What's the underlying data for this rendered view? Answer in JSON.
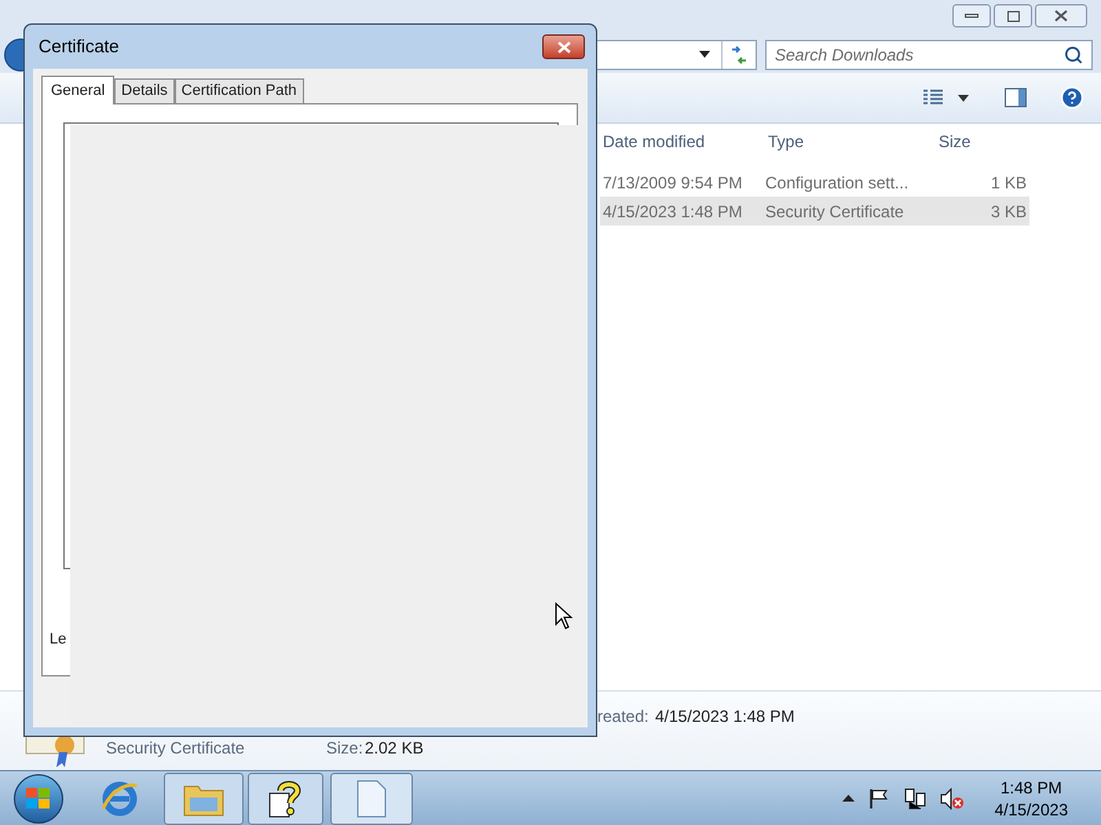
{
  "explorer": {
    "search": {
      "placeholder": "Search Downloads"
    },
    "columns": [
      "Date modified",
      "Type",
      "Size"
    ],
    "rows": [
      {
        "date": "7/13/2009 9:54 PM",
        "type": "Configuration sett...",
        "size": "1 KB",
        "selected": false
      },
      {
        "date": "4/15/2023 1:48 PM",
        "type": "Security Certificate",
        "size": "3 KB",
        "selected": true
      }
    ],
    "details": {
      "name": "Security Certificate",
      "size_label": "Size:",
      "size": "2.02 KB",
      "created_label": "reated:",
      "created": "4/15/2023 1:48 PM"
    }
  },
  "dialog": {
    "title": "Certificate",
    "tabs": [
      {
        "label": "General",
        "selected": true
      },
      {
        "label": "Details",
        "selected": false
      },
      {
        "label": "Certification Path",
        "selected": false
      }
    ],
    "fragment": "Le"
  },
  "taskbar": {
    "time": "1:48 PM",
    "date": "4/15/2023"
  }
}
